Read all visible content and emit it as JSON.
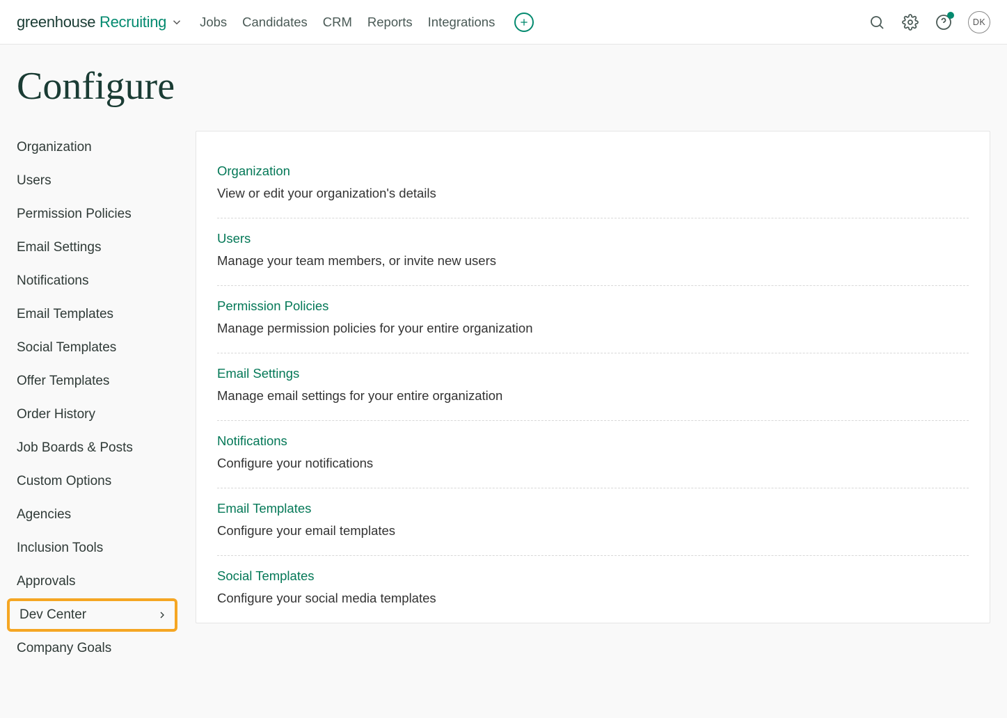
{
  "brand": {
    "g": "greenhouse",
    "r": " Recruiting"
  },
  "nav": {
    "links": [
      "Jobs",
      "Candidates",
      "CRM",
      "Reports",
      "Integrations"
    ]
  },
  "avatar": "DK",
  "page": {
    "title": "Configure"
  },
  "sidebar": {
    "items": [
      {
        "label": "Organization",
        "chevron": false,
        "highlight": false
      },
      {
        "label": "Users",
        "chevron": false,
        "highlight": false
      },
      {
        "label": "Permission Policies",
        "chevron": false,
        "highlight": false
      },
      {
        "label": "Email Settings",
        "chevron": false,
        "highlight": false
      },
      {
        "label": "Notifications",
        "chevron": false,
        "highlight": false
      },
      {
        "label": "Email Templates",
        "chevron": false,
        "highlight": false
      },
      {
        "label": "Social Templates",
        "chevron": false,
        "highlight": false
      },
      {
        "label": "Offer Templates",
        "chevron": false,
        "highlight": false
      },
      {
        "label": "Order History",
        "chevron": false,
        "highlight": false
      },
      {
        "label": "Job Boards & Posts",
        "chevron": false,
        "highlight": false
      },
      {
        "label": "Custom Options",
        "chevron": false,
        "highlight": false
      },
      {
        "label": "Agencies",
        "chevron": false,
        "highlight": false
      },
      {
        "label": "Inclusion Tools",
        "chevron": false,
        "highlight": false
      },
      {
        "label": "Approvals",
        "chevron": false,
        "highlight": false
      },
      {
        "label": "Dev Center",
        "chevron": true,
        "highlight": true
      },
      {
        "label": "Company Goals",
        "chevron": false,
        "highlight": false
      }
    ]
  },
  "main": {
    "rows": [
      {
        "title": "Organization",
        "desc": "View or edit your organization's details"
      },
      {
        "title": "Users",
        "desc": "Manage your team members, or invite new users"
      },
      {
        "title": "Permission Policies",
        "desc": "Manage permission policies for your entire organization"
      },
      {
        "title": "Email Settings",
        "desc": "Manage email settings for your entire organization"
      },
      {
        "title": "Notifications",
        "desc": "Configure your notifications"
      },
      {
        "title": "Email Templates",
        "desc": "Configure your email templates"
      },
      {
        "title": "Social Templates",
        "desc": "Configure your social media templates"
      }
    ]
  }
}
